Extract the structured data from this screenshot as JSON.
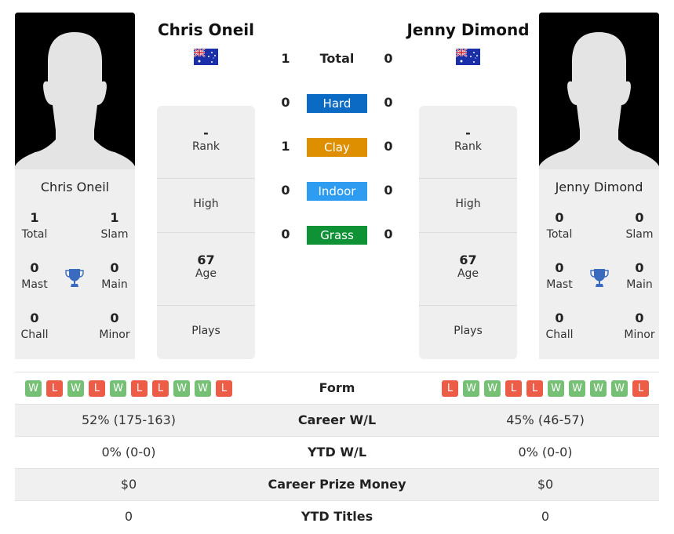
{
  "player1": {
    "name": "Chris Oneil",
    "country_flag": "australia-flag",
    "titles": {
      "total": {
        "value": "1",
        "label": "Total"
      },
      "slam": {
        "value": "1",
        "label": "Slam"
      },
      "mast": {
        "value": "0",
        "label": "Mast"
      },
      "main": {
        "value": "0",
        "label": "Main"
      },
      "chall": {
        "value": "0",
        "label": "Chall"
      },
      "minor": {
        "value": "0",
        "label": "Minor"
      }
    },
    "rank": {
      "value": "-",
      "label": "Rank"
    },
    "high": {
      "value": "",
      "label": "High"
    },
    "age": {
      "value": "67",
      "label": "Age"
    },
    "plays": {
      "value": "",
      "label": "Plays"
    },
    "form": [
      "W",
      "L",
      "W",
      "L",
      "W",
      "L",
      "L",
      "W",
      "W",
      "L"
    ],
    "career_wl": "52% (175-163)",
    "ytd_wl": "0% (0-0)",
    "career_prize": "$0",
    "ytd_titles": "0"
  },
  "player2": {
    "name": "Jenny Dimond",
    "country_flag": "australia-flag",
    "titles": {
      "total": {
        "value": "0",
        "label": "Total"
      },
      "slam": {
        "value": "0",
        "label": "Slam"
      },
      "mast": {
        "value": "0",
        "label": "Mast"
      },
      "main": {
        "value": "0",
        "label": "Main"
      },
      "chall": {
        "value": "0",
        "label": "Chall"
      },
      "minor": {
        "value": "0",
        "label": "Minor"
      }
    },
    "rank": {
      "value": "-",
      "label": "Rank"
    },
    "high": {
      "value": "",
      "label": "High"
    },
    "age": {
      "value": "67",
      "label": "Age"
    },
    "plays": {
      "value": "",
      "label": "Plays"
    },
    "form": [
      "L",
      "W",
      "W",
      "L",
      "L",
      "W",
      "W",
      "W",
      "W",
      "L"
    ],
    "career_wl": "45% (46-57)",
    "ytd_wl": "0% (0-0)",
    "career_prize": "$0",
    "ytd_titles": "0"
  },
  "h2h": {
    "total": {
      "label": "Total",
      "p1": "1",
      "p2": "0"
    },
    "surfaces": [
      {
        "label": "Hard",
        "p1": "0",
        "p2": "0",
        "color": "#0a6ac4"
      },
      {
        "label": "Clay",
        "p1": "1",
        "p2": "0",
        "color": "#de8f00"
      },
      {
        "label": "Indoor",
        "p1": "0",
        "p2": "0",
        "color": "#2e9cf1"
      },
      {
        "label": "Grass",
        "p1": "0",
        "p2": "0",
        "color": "#0f9235"
      }
    ]
  },
  "compare_labels": {
    "form": "Form",
    "career_wl": "Career W/L",
    "ytd_wl": "YTD W/L",
    "career_prize": "Career Prize Money",
    "ytd_titles": "YTD Titles"
  }
}
